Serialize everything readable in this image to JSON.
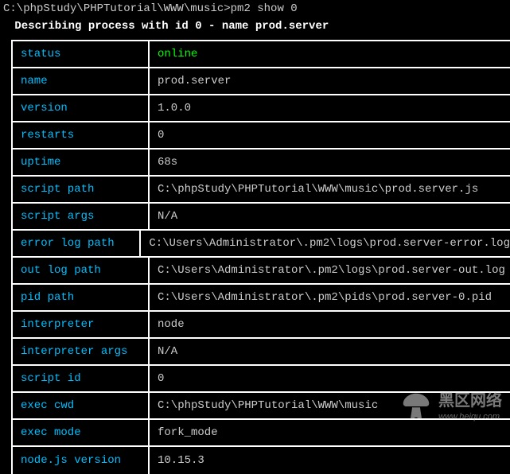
{
  "prompt": "C:\\phpStudy\\PHPTutorial\\WWW\\music>pm2 show 0",
  "describe": " Describing process with id 0 - name prod.server",
  "rows": [
    {
      "key": "status",
      "val": "online",
      "status": true
    },
    {
      "key": "name",
      "val": "prod.server"
    },
    {
      "key": "version",
      "val": "1.0.0"
    },
    {
      "key": "restarts",
      "val": "0"
    },
    {
      "key": "uptime",
      "val": "68s"
    },
    {
      "key": "script path",
      "val": "C:\\phpStudy\\PHPTutorial\\WWW\\music\\prod.server.js"
    },
    {
      "key": "script args",
      "val": "N/A"
    },
    {
      "key": "error log path",
      "val": "C:\\Users\\Administrator\\.pm2\\logs\\prod.server-error.log"
    },
    {
      "key": "out log path",
      "val": "C:\\Users\\Administrator\\.pm2\\logs\\prod.server-out.log"
    },
    {
      "key": "pid path",
      "val": "C:\\Users\\Administrator\\.pm2\\pids\\prod.server-0.pid"
    },
    {
      "key": "interpreter",
      "val": "node"
    },
    {
      "key": "interpreter args",
      "val": "N/A"
    },
    {
      "key": "script id",
      "val": "0"
    },
    {
      "key": "exec cwd",
      "val": "C:\\phpStudy\\PHPTutorial\\WWW\\music"
    },
    {
      "key": "exec mode",
      "val": "fork_mode"
    },
    {
      "key": "node.js version",
      "val": "10.15.3"
    }
  ],
  "watermark": {
    "cn": "黑区网络",
    "url": "www.heiqu.com"
  }
}
